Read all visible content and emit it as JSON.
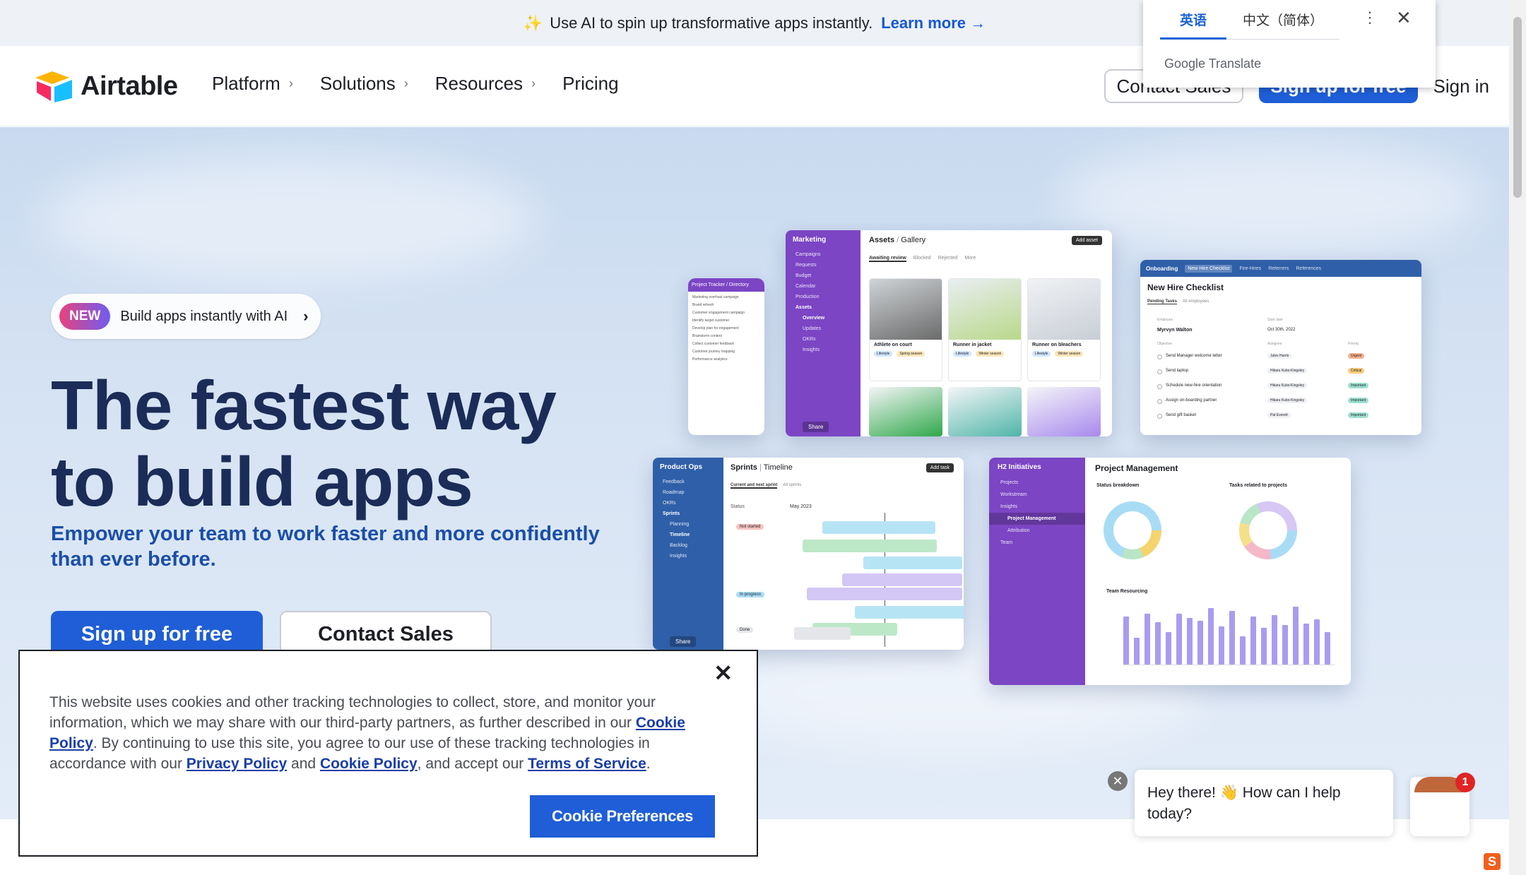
{
  "announcement": {
    "text": "Use AI to spin up transformative apps instantly.",
    "link": "Learn more →"
  },
  "header": {
    "brand": "Airtable",
    "nav": [
      {
        "label": "Platform",
        "has_chevron": true
      },
      {
        "label": "Solutions",
        "has_chevron": true
      },
      {
        "label": "Resources",
        "has_chevron": true
      },
      {
        "label": "Pricing",
        "has_chevron": false
      }
    ],
    "contact_sales": "Contact Sales",
    "sign_up": "Sign up for free",
    "sign_in": "Sign in"
  },
  "translate": {
    "tabs": [
      "英语",
      "中文（简体）"
    ],
    "active_tab": "英语",
    "brand": "Google Translate"
  },
  "hero": {
    "badge_pill": "NEW",
    "badge_text": "Build apps instantly with AI",
    "title_line1": "The fastest way",
    "title_line2": "to build apps",
    "subtitle": "Empower your team to work faster and more confidently than ever before.",
    "primary_cta": "Sign up for free",
    "secondary_cta": "Contact Sales"
  },
  "screens": {
    "tracker": {
      "title": "Project Tracker / Directory",
      "rows": [
        "Marketing overhaul campaign",
        "Brand refresh",
        "Customer engagement campaign",
        "Identify target customer",
        "Develop plan for engagement",
        "Brainstorm content",
        "Collect customer feedback",
        "Customer journey mapping",
        "Performance analytics"
      ]
    },
    "marketing": {
      "workspace": "Marketing",
      "sidebar": [
        "Campaigns",
        "Requests",
        "Budget",
        "Calendar",
        "Production",
        "Assets",
        "Overview",
        "Updates",
        "OKRs",
        "Insights"
      ],
      "title": "Assets",
      "view": "Gallery",
      "tabs": [
        "Awaiting review",
        "Blocked",
        "Rejected",
        "More"
      ],
      "add_button": "Add asset",
      "cards": [
        {
          "name": "Athlete on court",
          "tags": [
            "Lifestyle",
            "Spring season"
          ]
        },
        {
          "name": "Runner in jacket",
          "tags": [
            "Lifestyle",
            "Winter season"
          ]
        },
        {
          "name": "Runner on bleachers",
          "tags": [
            "Lifestyle",
            "Winter season"
          ]
        }
      ],
      "share": "Share"
    },
    "onboarding": {
      "workspace": "Onboarding",
      "tabs": [
        "New Hire Checklist",
        "Fire-Hires",
        "Referrers",
        "References"
      ],
      "title": "New Hire Checklist",
      "subtabs": [
        "Pending Tasks",
        "All employees"
      ],
      "employee_label": "Employee",
      "employee": "Myrvyn Walton",
      "start_label": "Start date",
      "start_date": "Oct 30th, 2022",
      "columns": [
        "Objective",
        "Assignee",
        "Priority"
      ],
      "tasks": [
        {
          "task": "Send Manager welcome letter",
          "assignee": "Jules Harris",
          "priority": "Urgent"
        },
        {
          "task": "Send laptop",
          "assignee": "Hikaru Kubo-Kingsley",
          "priority": "Critical"
        },
        {
          "task": "Schedule new-hire orientation",
          "assignee": "Hikaru Kubo-Kingsley",
          "priority": "Important"
        },
        {
          "task": "Assign on-boarding partner",
          "assignee": "Hikaru Kubo-Kingsley",
          "priority": "Important"
        },
        {
          "task": "Send gift basket",
          "assignee": "Pat Everett",
          "priority": "Important"
        }
      ]
    },
    "sprints": {
      "workspace": "Product Ops",
      "sidebar": [
        "Feedback",
        "Roadmap",
        "OKRs",
        "Sprints",
        "Planning",
        "Timeline",
        "Backlog",
        "Insights"
      ],
      "title": "Sprints",
      "view": "Timeline",
      "tabs": [
        "Current and next sprint",
        "All sprints"
      ],
      "add_button": "Add task",
      "status_label": "Status",
      "month": "May 2023",
      "groups": [
        "Not started",
        "In progress",
        "Done"
      ],
      "share": "Share"
    },
    "initiatives": {
      "workspace": "H2 Initiatives",
      "sidebar": [
        "Projects",
        "Workstream",
        "Insights",
        "Project Management",
        "Attribution",
        "Team"
      ],
      "title": "Project Management",
      "status_breakdown": "Status breakdown",
      "tasks_related": "Tasks related to projects",
      "team_resourcing": "Team Resourcing",
      "bars": [
        68,
        38,
        72,
        60,
        46,
        72,
        66,
        62,
        80,
        54,
        76,
        40,
        68,
        52,
        70,
        56,
        82,
        58,
        64,
        46
      ]
    }
  },
  "cookie": {
    "text_part1": "This website uses cookies and other tracking technologies to collect, store, and monitor your information, which we may share with our third-party partners, as further described in our ",
    "link_cookie1": "Cookie Policy",
    "text_part2": ". By continuing to use this site, you agree to our use of these tracking technologies in accordance with our ",
    "link_privacy": "Privacy Policy",
    "text_part3": " and ",
    "link_cookie2": "Cookie Policy",
    "text_part4": ", and accept our ",
    "link_terms": "Terms of Service",
    "text_part5": ".",
    "button": "Cookie Preferences"
  },
  "chat": {
    "message": "Hey there! 👋 How can I help today?",
    "unread": "1"
  },
  "colors": {
    "primary": "#1f5ed6",
    "hero_title": "#1b2c58",
    "hero_sub": "#1a4ea8",
    "purple": "#7b45c4",
    "navy": "#2f5fa8"
  }
}
